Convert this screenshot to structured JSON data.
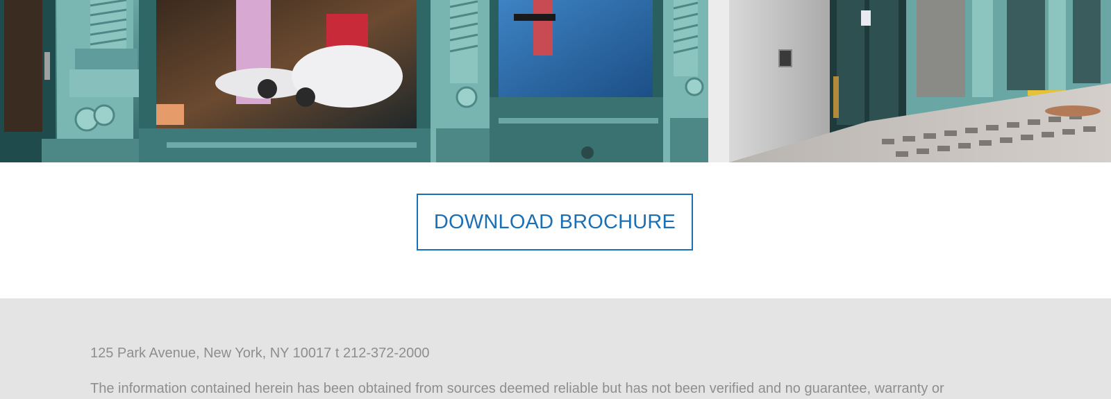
{
  "hero": {
    "image_alt": "Teal cast-iron storefront with display windows and sidewalk"
  },
  "cta": {
    "download_label": "DOWNLOAD BROCHURE"
  },
  "footer": {
    "address": "125 Park Avenue, New York, NY 10017 t 212-372-2000",
    "disclaimer": "The information contained herein has been obtained from sources deemed reliable but has not been verified and no guarantee, warranty or"
  },
  "colors": {
    "accent_blue": "#1a6fb5",
    "footer_bg": "#e4e4e4",
    "footer_text": "#8e8e8e",
    "facade_teal": "#5f9c9b"
  }
}
